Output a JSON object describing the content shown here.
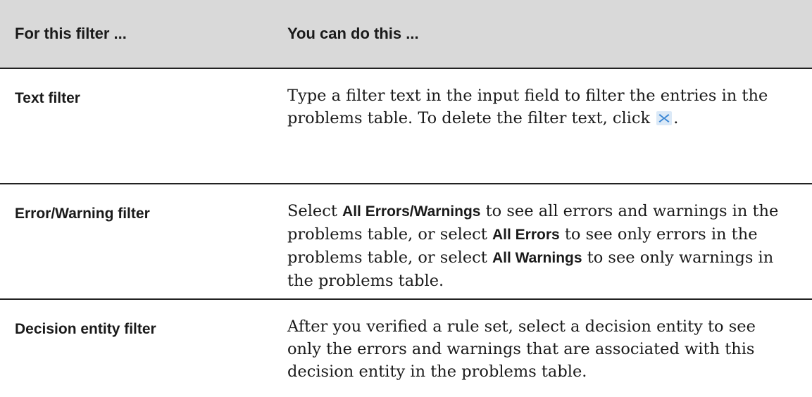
{
  "table": {
    "header": {
      "col1": "For this filter ...",
      "col2": "You can do this ..."
    },
    "rows": [
      {
        "filter": "Text filter",
        "desc": {
          "part1": "Type a filter text in the input field to filter the entries in the problems table. To delete the filter text, click",
          "icon": "close-icon",
          "part2": "."
        }
      },
      {
        "filter": "Error/Warning filter",
        "desc": {
          "part1": "Select",
          "kw1": "All Errors/Warnings",
          "part2": "to see all errors and warnings in the problems table, or select",
          "kw2": "All Errors",
          "part3": "to see only errors in the problems table, or select",
          "kw3": "All Warnings",
          "part4": "to see only warnings in the problems table."
        }
      },
      {
        "filter": "Decision entity filter",
        "desc": {
          "part1": "After you verified a rule set, select a decision entity to see only the errors and warnings that are associated with this decision entity in the problems table."
        }
      }
    ]
  },
  "colors": {
    "header_bg": "#d9d9d9",
    "icon_blue": "#3a86d4"
  }
}
